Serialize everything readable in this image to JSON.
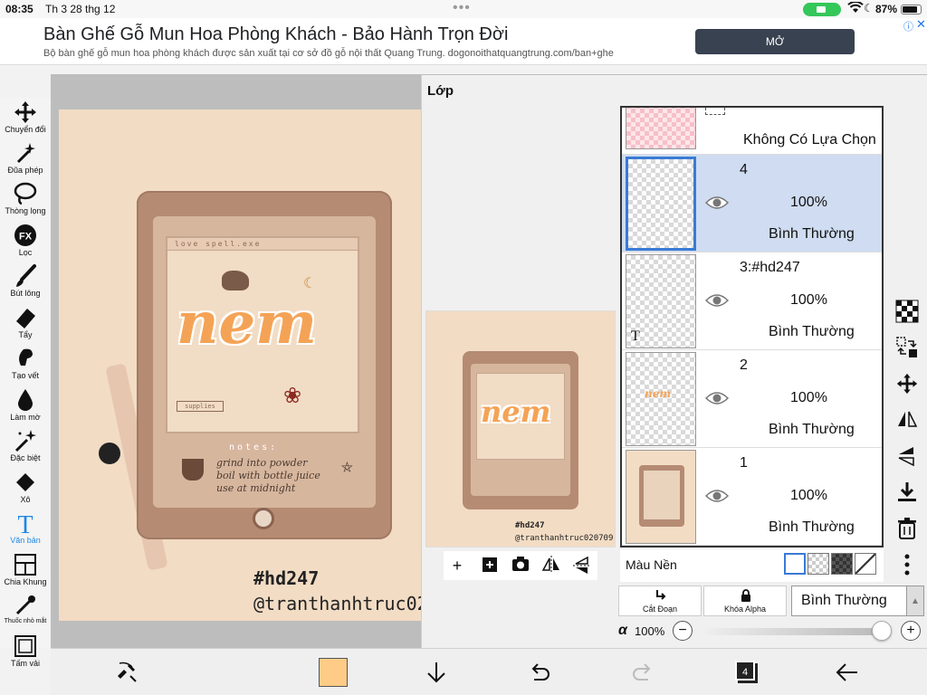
{
  "status_bar": {
    "time": "08:35",
    "date": "Th 3 28 thg 12",
    "battery": "87%"
  },
  "ad": {
    "title": "Bàn Ghế Gỗ Mun Hoa Phòng Khách - Bảo Hành Trọn Đời",
    "subtitle": "Bộ bàn ghế gỗ mun hoa phòng khách được sản xuất tại cơ sở đồ gỗ nội thất Quang Trung. dogonoithatquangtrung.com/ban+ghe",
    "button": "MỞ"
  },
  "tools": [
    {
      "label": "Chuyển đổi",
      "icon": "move-icon"
    },
    {
      "label": "Đũa phép",
      "icon": "magic-wand-icon"
    },
    {
      "label": "Thòng lọng",
      "icon": "lasso-icon"
    },
    {
      "label": "Lọc",
      "icon": "fx-icon"
    },
    {
      "label": "Bút lông",
      "icon": "brush-icon"
    },
    {
      "label": "Tẩy",
      "icon": "eraser-icon"
    },
    {
      "label": "Tạo vết",
      "icon": "smudge-icon"
    },
    {
      "label": "Làm mờ",
      "icon": "blur-icon"
    },
    {
      "label": "Đặc biệt",
      "icon": "special-icon"
    },
    {
      "label": "Xô",
      "icon": "bucket-icon"
    },
    {
      "label": "Văn bản",
      "icon": "text-icon",
      "active": true
    },
    {
      "label": "Chia Khung",
      "icon": "frame-divider-icon"
    },
    {
      "label": "Thuốc nhỏ mắt",
      "icon": "eyedropper-icon"
    },
    {
      "label": "Tấm vải",
      "icon": "canvas-icon"
    }
  ],
  "artwork": {
    "window_title": "love spell.exe",
    "word": "nem",
    "supplies": "supplies",
    "notes_label": "notes:",
    "notes": [
      "grind into powder",
      "boil with bottle juice",
      "use at midnight"
    ],
    "hashtag": "#hd247",
    "handle": "@tranthanhtruc020709"
  },
  "layer_panel": {
    "title": "Lớp",
    "selection_row": "Không Có Lựa Chọn",
    "layers": [
      {
        "name": "4",
        "opacity": "100%",
        "blend": "Bình Thường",
        "selected": true
      },
      {
        "name": "3:#hd247",
        "opacity": "100%",
        "blend": "Bình Thường",
        "text_layer": true
      },
      {
        "name": "2",
        "opacity": "100%",
        "blend": "Bình Thường"
      },
      {
        "name": "1",
        "opacity": "100%",
        "blend": "Bình Thường"
      }
    ],
    "background_label": "Màu Nền",
    "clip_label": "Cắt Đoạn",
    "alpha_lock_label": "Khóa Alpha",
    "blend_mode": "Bình Thường",
    "alpha_symbol": "α",
    "opacity": "100%"
  },
  "bottom_bar": {
    "primary_color": "#ffcc88",
    "layer_count": "4"
  }
}
